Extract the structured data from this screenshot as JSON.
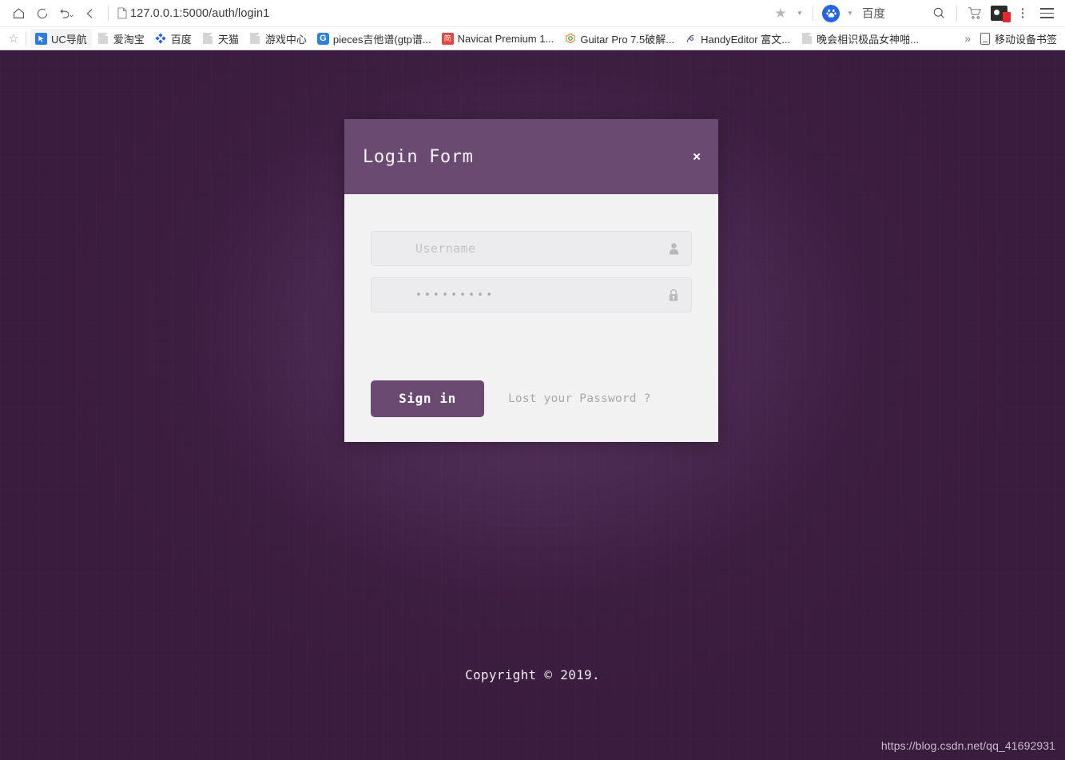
{
  "browser": {
    "toolbar": {
      "home_icon": "home-icon",
      "reload_icon": "reload-icon",
      "history_back_icon": "history-dropdown-icon",
      "back_icon": "back-arrow-icon",
      "page_icon": "page-document-icon",
      "url": "127.0.0.1:5000/auth/login1",
      "bookmark_star_icon": "star-icon",
      "star_dropdown_icon": "chevron-down-icon",
      "search_engine_icon": "baidu-paw-icon",
      "search_engine_dropdown_icon": "chevron-down-icon",
      "search_engine_label": "百度",
      "search_icon": "search-magnifier-icon",
      "cart_icon": "shopping-cart-icon",
      "extension_icon": "extension-badge-icon",
      "more_icon": "more-vertical-icon",
      "menu_icon": "hamburger-menu-icon"
    },
    "bookmarks": {
      "star_icon": "bookmark-star-icon",
      "items": [
        {
          "label": "UC导航",
          "icon": "uc-cursor-icon",
          "active": true
        },
        {
          "label": "爱淘宝",
          "icon": "document-icon",
          "active": false
        },
        {
          "label": "百度",
          "icon": "baidu-icon",
          "active": false
        },
        {
          "label": "天猫",
          "icon": "document-icon",
          "active": false
        },
        {
          "label": "游戏中心",
          "icon": "document-icon",
          "active": false
        },
        {
          "label": "pieces吉他谱(gtp谱...",
          "icon": "g-icon",
          "active": false
        },
        {
          "label": "Navicat Premium 1...",
          "icon": "jian-icon",
          "active": false
        },
        {
          "label": "Guitar Pro 7.5破解...",
          "icon": "guitar-pro-icon",
          "active": false
        },
        {
          "label": "HandyEditor 富文...",
          "icon": "handy-editor-icon",
          "active": false
        },
        {
          "label": "晚会相识极品女神啪...",
          "icon": "document-icon",
          "active": false
        }
      ],
      "overflow_label": "»",
      "mobile_bookmarks_label": "移动设备书签",
      "mobile_bookmarks_icon": "mobile-device-icon"
    }
  },
  "page": {
    "background_color": "#3a1c3e",
    "accent_color": "#6b4a72",
    "modal": {
      "title": "Login Form",
      "close_icon": "close-icon",
      "close_label": "×",
      "username": {
        "placeholder": "Username",
        "value": "",
        "icon": "user-person-icon"
      },
      "password": {
        "placeholder": "",
        "value": "•••••••••",
        "icon": "lock-padlock-icon"
      },
      "signin_label": "Sign in",
      "lost_password_label": "Lost your Password ?"
    },
    "copyright": "Copyright © 2019.",
    "watermark": "https://blog.csdn.net/qq_41692931"
  }
}
